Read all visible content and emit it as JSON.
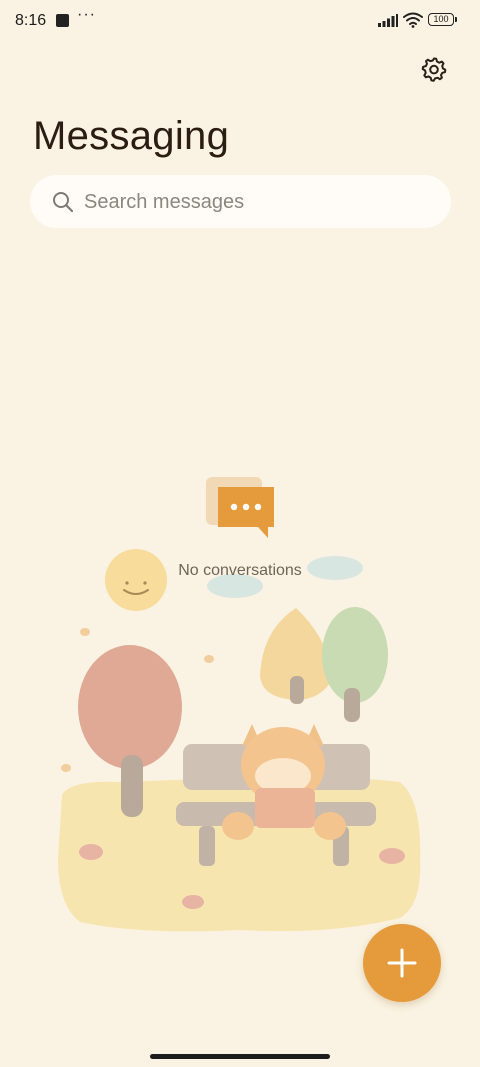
{
  "status_bar": {
    "time": "8:16",
    "more": "···",
    "battery": "100"
  },
  "header": {
    "title": "Messaging",
    "settings_icon": "gear-icon"
  },
  "search": {
    "placeholder": "Search messages",
    "icon": "search-icon"
  },
  "empty_state": {
    "message": "No conversations",
    "icon": "chat-bubble-icon",
    "illustration": "fox-reading-on-bench-autumn"
  },
  "fab": {
    "icon": "plus-icon"
  },
  "colors": {
    "background": "#faf3e3",
    "accent": "#e59b3b",
    "search_background": "#fffcf7"
  }
}
